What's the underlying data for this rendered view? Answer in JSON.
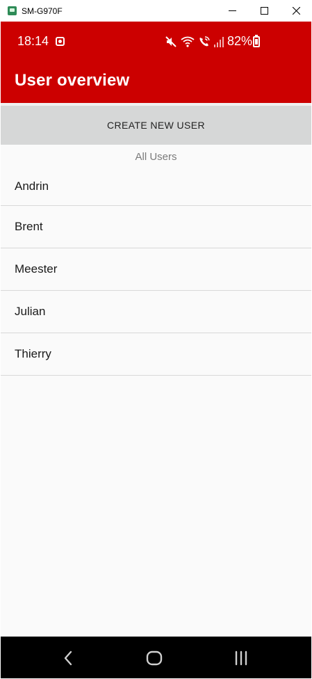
{
  "window": {
    "title": "SM-G970F",
    "app_icon": "android-app-icon",
    "controls": [
      "minimize-icon",
      "maximize-icon",
      "close-icon"
    ]
  },
  "status_bar": {
    "time": "18:14",
    "battery": "82%",
    "icons": [
      "notification-icon",
      "mute-icon",
      "wifi-icon",
      "wifi-calling-icon",
      "signal-icon",
      "battery-charging-icon"
    ]
  },
  "app_bar": {
    "title": "User overview"
  },
  "create_button": {
    "label": "CREATE NEW USER"
  },
  "users_section": {
    "label": "All Users",
    "users": [
      "Andrin",
      "Brent",
      "Meester",
      "Julian",
      "Thierry"
    ]
  },
  "nav_bar": {
    "buttons": [
      "back-icon",
      "home-icon",
      "recents-icon"
    ]
  },
  "colors": {
    "primary": "#cc0000",
    "button_bg": "#d6d7d7",
    "background": "#fafafa"
  }
}
